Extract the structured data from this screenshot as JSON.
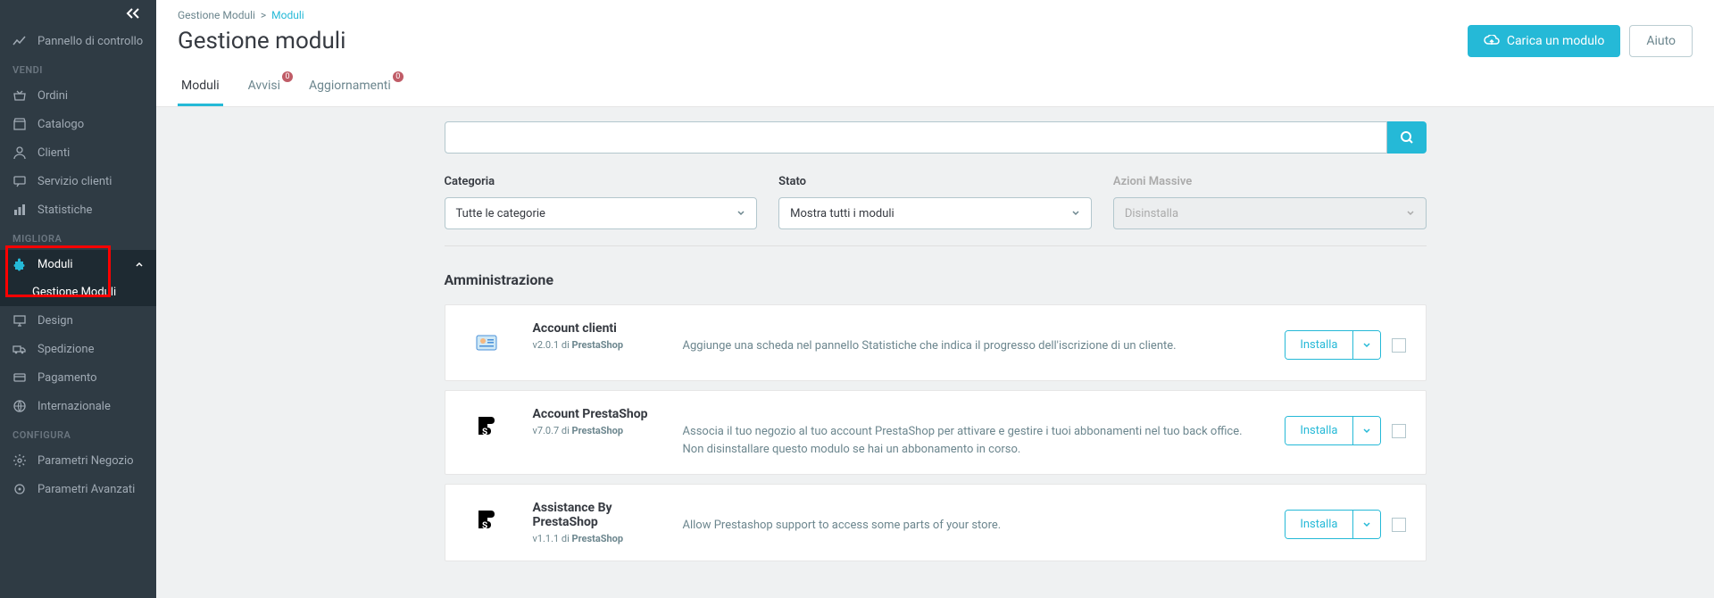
{
  "sidebar": {
    "dashboard": "Pannello di controllo",
    "sections": {
      "vendi": {
        "label": "VENDI",
        "items": [
          {
            "label": "Ordini"
          },
          {
            "label": "Catalogo"
          },
          {
            "label": "Clienti"
          },
          {
            "label": "Servizio clienti"
          },
          {
            "label": "Statistiche"
          }
        ]
      },
      "migliora": {
        "label": "MIGLIORA",
        "items": [
          {
            "label": "Moduli",
            "subitems": [
              {
                "label": "Gestione Moduli"
              }
            ]
          },
          {
            "label": "Design"
          },
          {
            "label": "Spedizione"
          },
          {
            "label": "Pagamento"
          },
          {
            "label": "Internazionale"
          }
        ]
      },
      "configura": {
        "label": "CONFIGURA",
        "items": [
          {
            "label": "Parametri Negozio"
          },
          {
            "label": "Parametri Avanzati"
          }
        ]
      }
    }
  },
  "breadcrumb": {
    "parent": "Gestione Moduli",
    "current": "Moduli"
  },
  "page_title": "Gestione moduli",
  "header_actions": {
    "upload": "Carica un modulo",
    "help": "Aiuto"
  },
  "tabs": [
    {
      "label": "Moduli",
      "badge": null
    },
    {
      "label": "Avvisi",
      "badge": "0"
    },
    {
      "label": "Aggiornamenti",
      "badge": "0"
    }
  ],
  "filters": {
    "category_label": "Categoria",
    "category_value": "Tutte le categorie",
    "state_label": "Stato",
    "state_value": "Mostra tutti i moduli",
    "bulk_label": "Azioni Massive",
    "bulk_value": "Disinstalla"
  },
  "section_heading": "Amministrazione",
  "install_label": "Installa",
  "by_label": "di",
  "modules": [
    {
      "name": "Account clienti",
      "version": "v2.0.1",
      "author": "PrestaShop",
      "desc": "Aggiunge una scheda nel pannello Statistiche che indica il progresso dell'iscrizione di un cliente."
    },
    {
      "name": "Account PrestaShop",
      "version": "v7.0.7",
      "author": "PrestaShop",
      "desc": "Associa il tuo negozio al tuo account PrestaShop per attivare e gestire i tuoi abbonamenti nel tuo back office. Non disinstallare questo modulo se hai un abbonamento in corso."
    },
    {
      "name": "Assistance By PrestaShop",
      "version": "v1.1.1",
      "author": "PrestaShop",
      "desc": "Allow Prestashop support to access some parts of your store."
    }
  ]
}
